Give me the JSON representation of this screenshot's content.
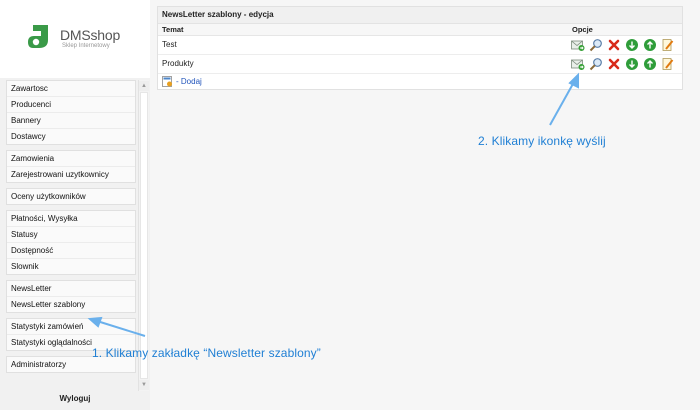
{
  "logo": {
    "name": "DMSshop",
    "tagline": "Sklep Internetowy"
  },
  "sidebar": {
    "groups": [
      [
        "Zawartosc",
        "Producenci",
        "Bannery",
        "Dostawcy"
      ],
      [
        "Zamowienia",
        "Zarejestrowani uzytkownicy"
      ],
      [
        "Oceny użytkowników"
      ],
      [
        "Płatności, Wysyłka",
        "Statusy",
        "Dostępność",
        "Slownik"
      ],
      [
        "NewsLetter",
        "NewsLetter szablony"
      ],
      [
        "Statystyki zamówień",
        "Statystyki oglądalności"
      ],
      [
        "Administratorzy"
      ]
    ],
    "logout": "Wyloguj"
  },
  "panel": {
    "title": "NewsLetter szablony - edycja",
    "col_topic": "Temat",
    "col_options": "Opcje",
    "rows": [
      {
        "name": "Test"
      },
      {
        "name": "Produkty"
      }
    ],
    "add_label": "- Dodaj"
  },
  "action_icons": [
    "send-mail-icon",
    "preview-icon",
    "delete-icon",
    "move-down-icon",
    "move-up-icon",
    "edit-icon"
  ],
  "annotations": {
    "step1": "1. Klikamy zakładkę “Newsletter szablony”",
    "step2": "2. Klikamy ikonkę wyślij"
  },
  "colors": {
    "annotation": "#1f7fd4",
    "link": "#2255bb",
    "logo_green": "#3a9a48"
  }
}
